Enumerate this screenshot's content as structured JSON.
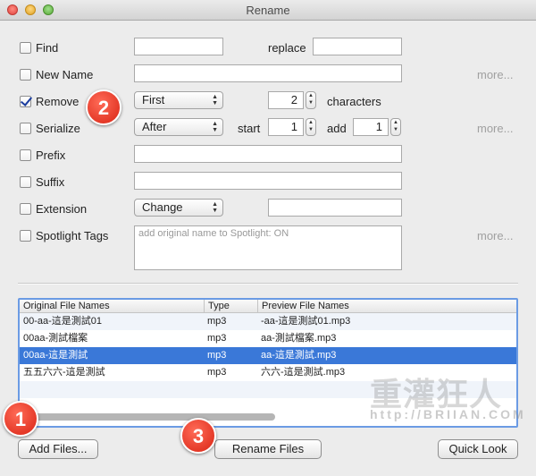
{
  "window": {
    "title": "Rename"
  },
  "options": {
    "find": {
      "label": "Find",
      "checked": false,
      "value": "",
      "replace_label": "replace",
      "replace_value": ""
    },
    "new_name": {
      "label": "New Name",
      "checked": false,
      "value": "",
      "more": "more..."
    },
    "remove": {
      "label": "Remove",
      "checked": true,
      "mode": "First",
      "count": "2",
      "unit_label": "characters"
    },
    "serialize": {
      "label": "Serialize",
      "checked": false,
      "mode": "After",
      "start_label": "start",
      "start": "1",
      "add_label": "add",
      "add": "1",
      "more": "more..."
    },
    "prefix": {
      "label": "Prefix",
      "checked": false,
      "value": ""
    },
    "suffix": {
      "label": "Suffix",
      "checked": false,
      "value": ""
    },
    "extension": {
      "label": "Extension",
      "checked": false,
      "mode": "Change",
      "value": ""
    },
    "spotlight": {
      "label": "Spotlight Tags",
      "checked": false,
      "placeholder": "add original name to Spotlight: ON",
      "more": "more..."
    }
  },
  "table": {
    "columns": [
      "Original File Names",
      "Type",
      "Preview File Names"
    ],
    "rows": [
      {
        "original": "00-aa-這是測試01",
        "type": "mp3",
        "preview": "-aa-這是測試01.mp3"
      },
      {
        "original": "00aa-測試檔案",
        "type": "mp3",
        "preview": "aa-測試檔案.mp3"
      },
      {
        "original": "00aa-這是測試",
        "type": "mp3",
        "preview": "aa-這是測試.mp3"
      },
      {
        "original": "五五六六-這是測試",
        "type": "mp3",
        "preview": "六六-這是測試.mp3"
      }
    ],
    "selected_row": 2
  },
  "buttons": {
    "add_files": "Add Files...",
    "rename_files": "Rename Files",
    "quick_look": "Quick Look"
  },
  "callouts": {
    "one": "1",
    "two": "2",
    "three": "3"
  },
  "watermark": {
    "text_cn": "重灌狂人",
    "url": "http://BRIIAN.COM"
  }
}
